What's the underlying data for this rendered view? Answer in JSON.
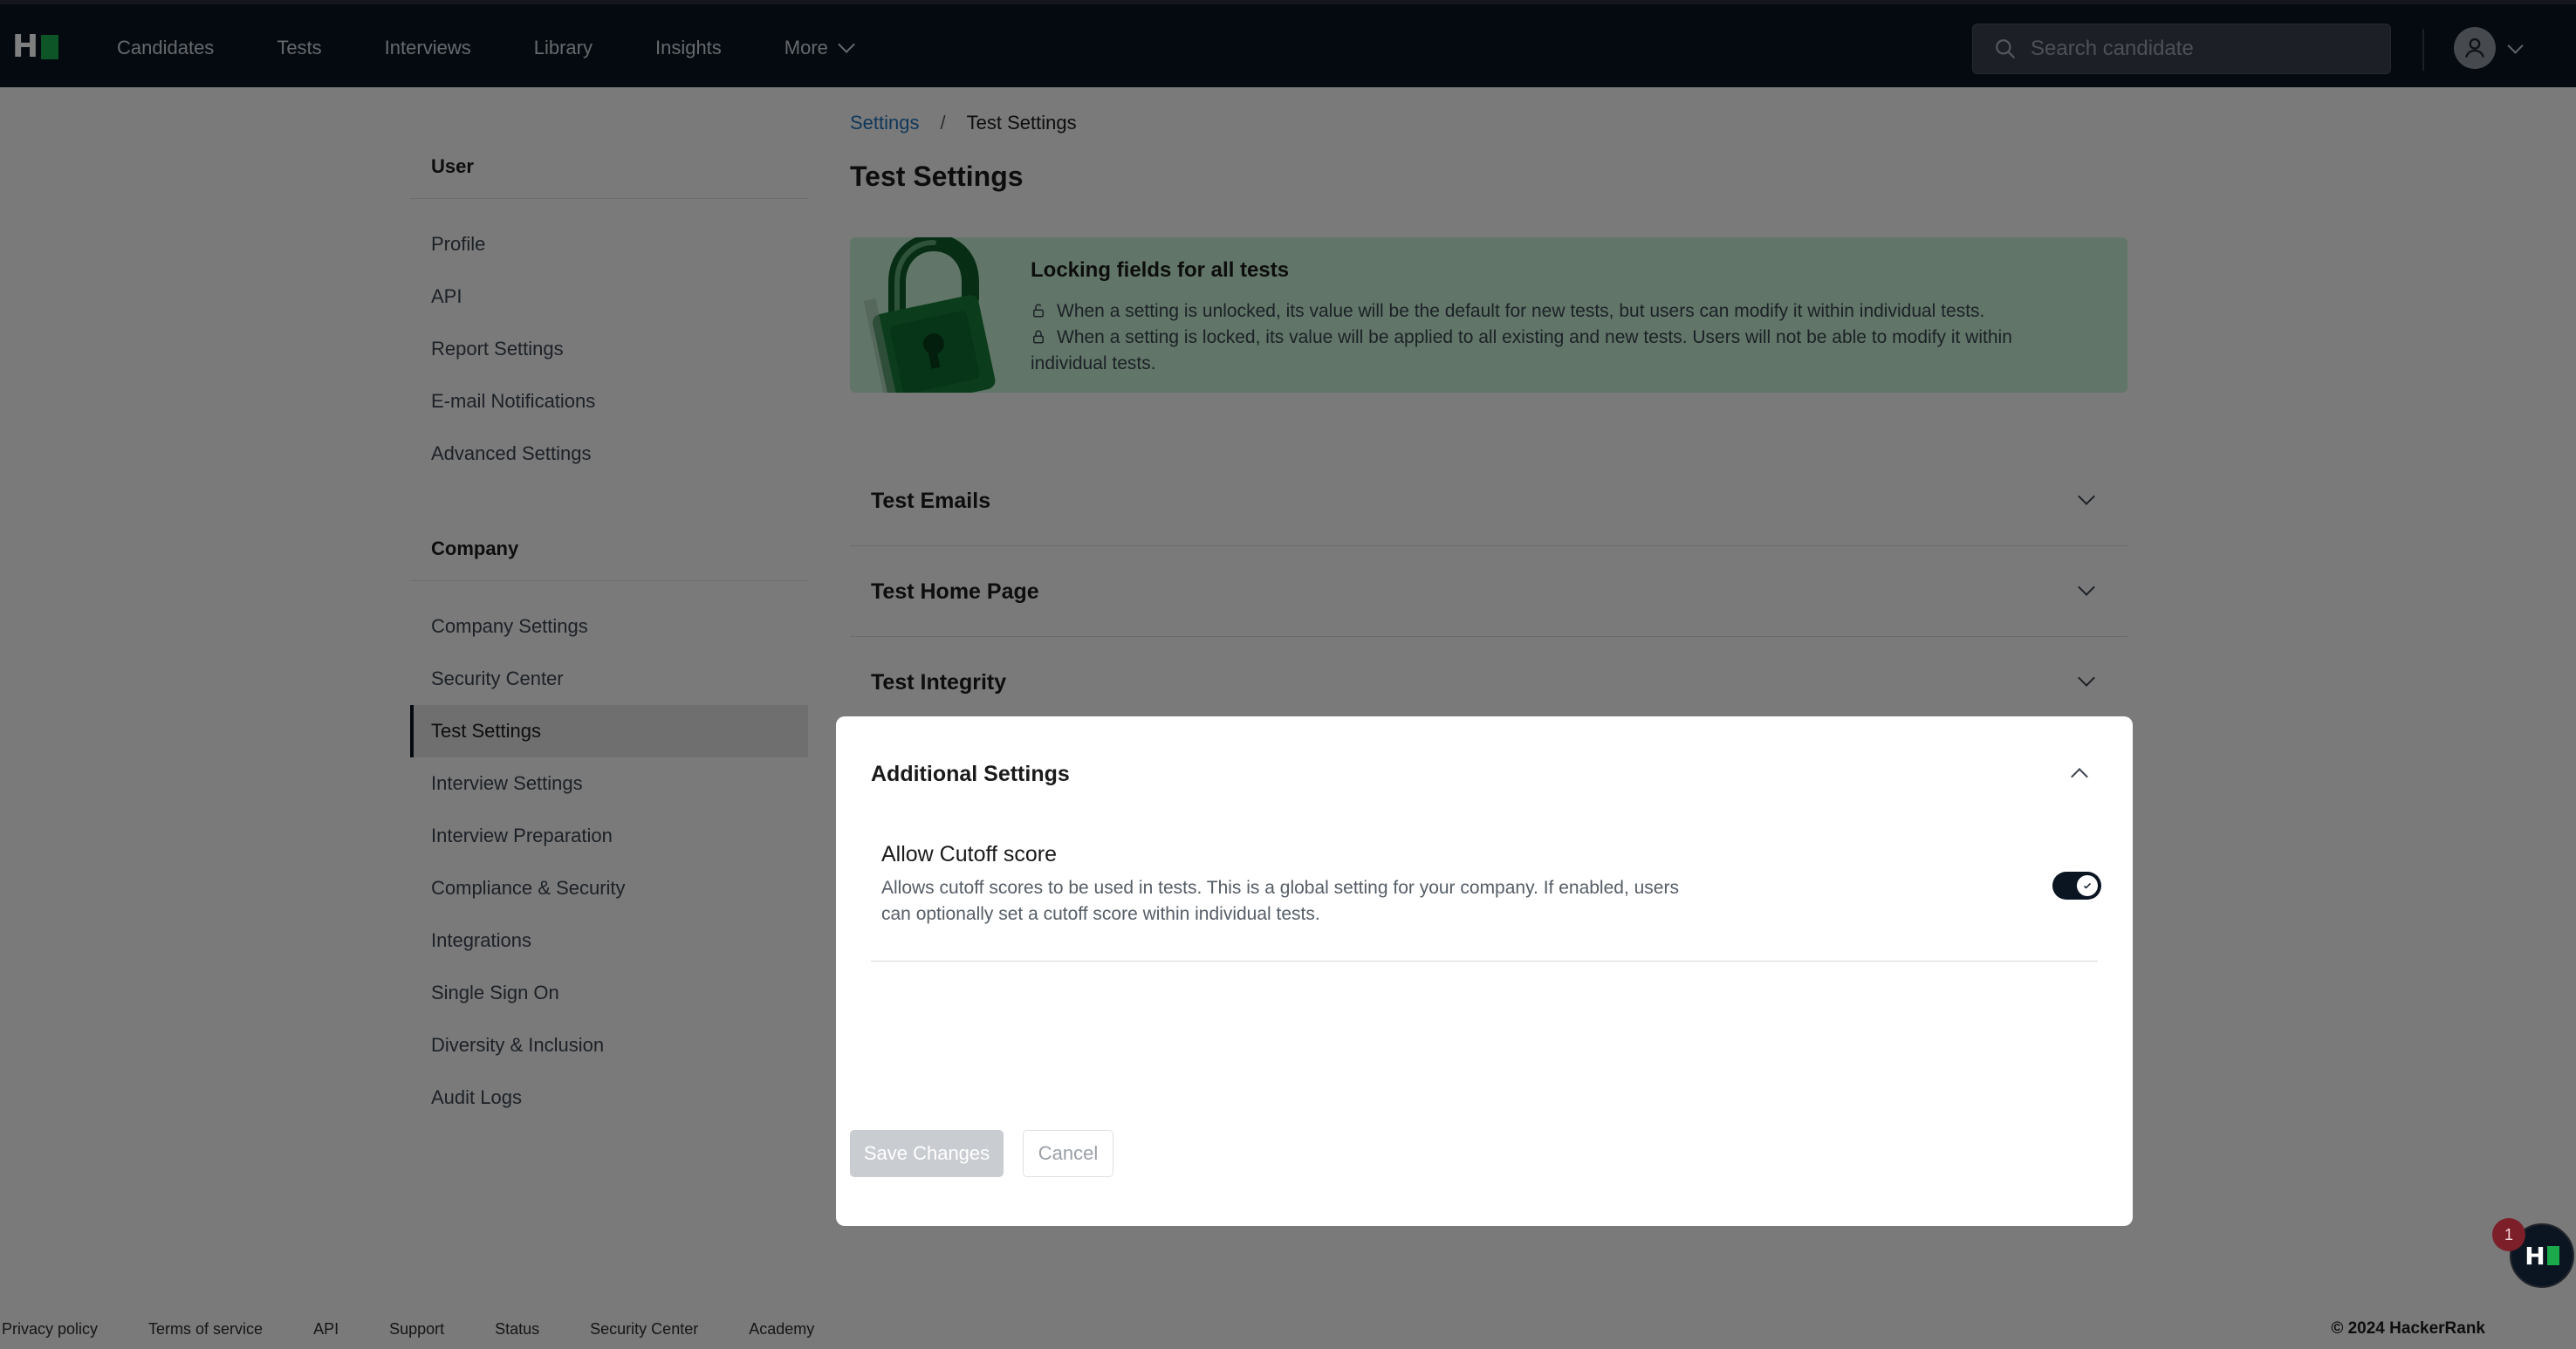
{
  "nav": {
    "logo_letter": "H",
    "items": [
      "Candidates",
      "Tests",
      "Interviews",
      "Library",
      "Insights",
      "More"
    ],
    "search_placeholder": "Search candidate"
  },
  "sidebar": {
    "user_heading": "User",
    "user_items": [
      "Profile",
      "API",
      "Report Settings",
      "E-mail Notifications",
      "Advanced Settings"
    ],
    "company_heading": "Company",
    "company_items": [
      "Company Settings",
      "Security Center",
      "Test Settings",
      "Interview Settings",
      "Interview Preparation",
      "Compliance & Security",
      "Integrations",
      "Single Sign On",
      "Diversity & Inclusion",
      "Audit Logs"
    ],
    "active_item": "Test Settings"
  },
  "breadcrumb": {
    "root": "Settings",
    "separator": "/",
    "current": "Test Settings"
  },
  "page_title": "Test Settings",
  "banner": {
    "title": "Locking fields for all tests",
    "unlocked_text": "When a setting is unlocked, its value will be the default for new tests, but users can modify it within individual tests.",
    "locked_text": "When a setting is locked, its value will be applied to all existing and new tests. Users will not be able to modify it within individual tests."
  },
  "sections": [
    "Test Emails",
    "Test Home Page",
    "Test Integrity"
  ],
  "panel": {
    "title": "Additional Settings",
    "setting_title": "Allow Cutoff score",
    "setting_desc": "Allows cutoff scores to be used in tests. This is a global setting for your company. If enabled, users can optionally set a cutoff score within individual tests.",
    "toggle_on": true,
    "save_label": "Save Changes",
    "cancel_label": "Cancel"
  },
  "footer": {
    "links": [
      "Privacy policy",
      "Terms of service",
      "API",
      "Support",
      "Status",
      "Security Center",
      "Academy"
    ],
    "copyright": "© 2024 HackerRank"
  },
  "chat": {
    "badge_count": "1",
    "logo_letter": "H"
  },
  "colors": {
    "navbar": "#0b1522",
    "brand_green": "#1ba94c",
    "banner_bg": "#c3ecd0",
    "link": "#1f6fb5"
  }
}
